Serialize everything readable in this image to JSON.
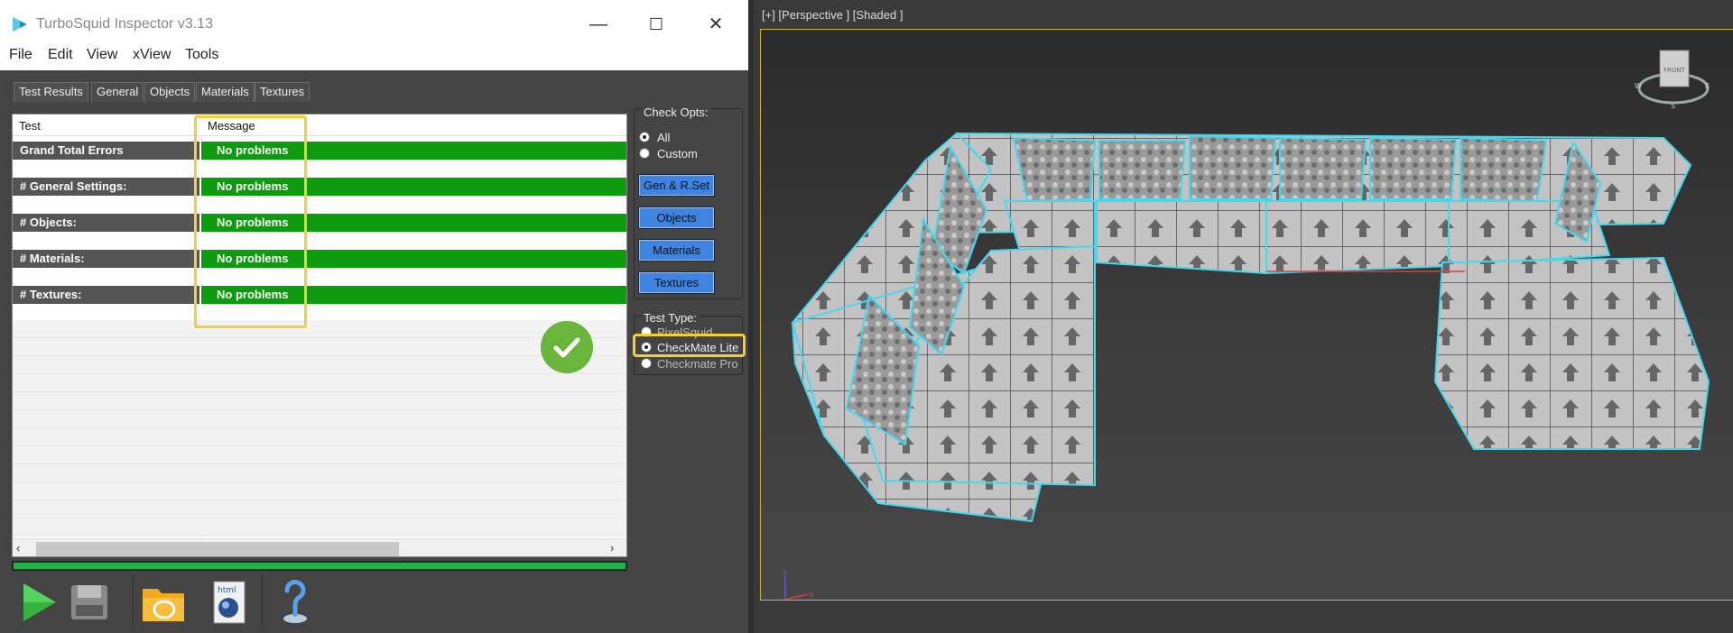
{
  "window": {
    "title": "TurboSquid Inspector v3.13",
    "controls": {
      "minimize": "—",
      "maximize": "☐",
      "close": "✕"
    }
  },
  "menu": [
    "File",
    "Edit",
    "View",
    "xView",
    "Tools"
  ],
  "tabs": [
    {
      "label": "Test Results",
      "active": true
    },
    {
      "label": "General",
      "active": false
    },
    {
      "label": "Objects",
      "active": false
    },
    {
      "label": "Materials",
      "active": false
    },
    {
      "label": "Textures",
      "active": false
    }
  ],
  "results": {
    "columns": [
      "Test",
      "Message"
    ],
    "rows": [
      {
        "test": "Grand Total Errors",
        "message": "No problems"
      },
      {
        "test": "# General Settings:",
        "message": "No problems"
      },
      {
        "test": "# Objects:",
        "message": "No problems"
      },
      {
        "test": "# Materials:",
        "message": "No problems"
      },
      {
        "test": "# Textures:",
        "message": "No problems"
      }
    ],
    "status_icon": "checkmark-icon",
    "progress": 1.0
  },
  "check_opts": {
    "title": "Check Opts:",
    "options": [
      {
        "label": "All",
        "selected": true
      },
      {
        "label": "Custom",
        "selected": false
      }
    ],
    "buttons": [
      "Gen & R.Set",
      "Objects",
      "Materials",
      "Textures"
    ]
  },
  "test_type": {
    "title": "Test Type:",
    "options": [
      {
        "label": "PixelSquid",
        "selected": false
      },
      {
        "label": "CheckMate Lite",
        "selected": true
      },
      {
        "label": "Checkmate Pro",
        "selected": false
      }
    ]
  },
  "toolbar": [
    "play-icon",
    "save-icon",
    "folder-icon",
    "html-report-icon",
    "help-icon"
  ],
  "viewport": {
    "label": "[+] [Perspective ] [Shaded ]",
    "viewcube": {
      "face": "FRONT",
      "west": "W",
      "east": "E",
      "south": "S"
    },
    "axis": {
      "z": "z",
      "x": "x"
    }
  },
  "colors": {
    "pass": "#0d9a0d",
    "test_cell": "#555555",
    "highlight": "#f5cf3a",
    "option_button": "#3f84e0",
    "wireframe": "#44d8f0",
    "viewport_border": "#c9b33c"
  }
}
